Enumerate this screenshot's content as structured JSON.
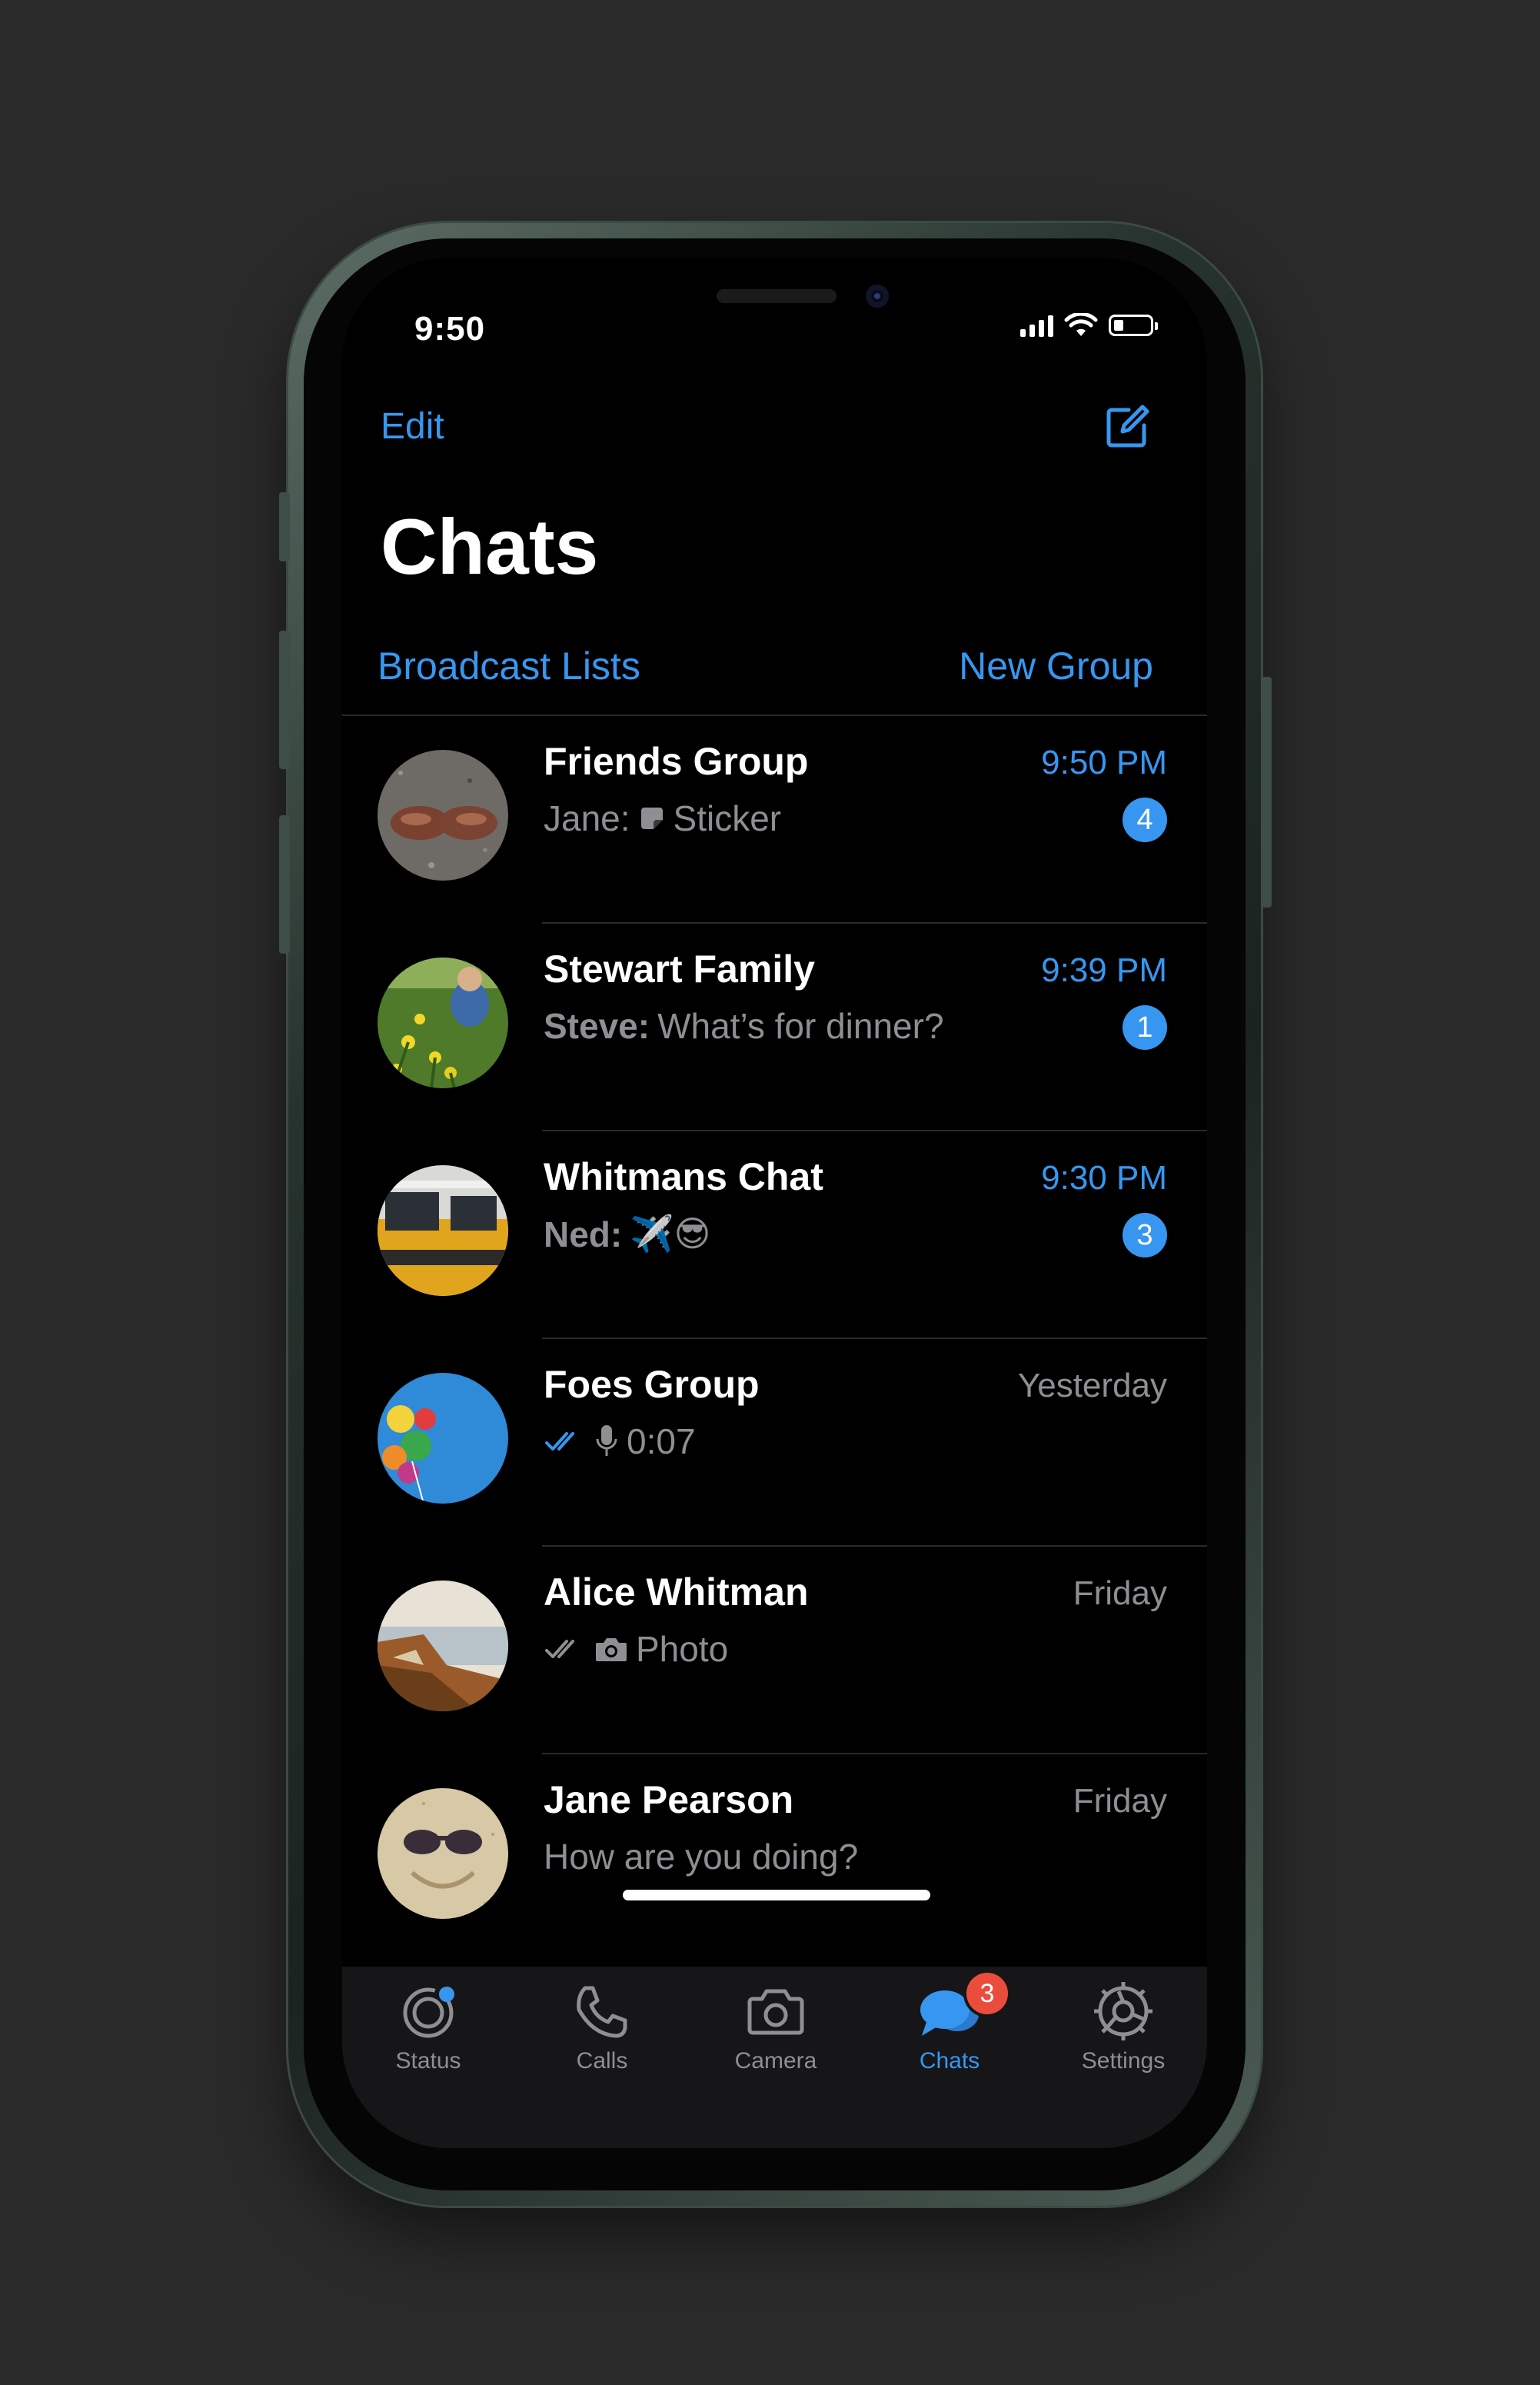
{
  "status_bar": {
    "time": "9:50"
  },
  "header": {
    "edit_label": "Edit",
    "title": "Chats",
    "broadcast_label": "Broadcast Lists",
    "new_group_label": "New Group"
  },
  "chats": [
    {
      "name": "Friends Group",
      "sender": "Jane:",
      "preview": "Sticker",
      "time": "9:50 PM",
      "unread": "4"
    },
    {
      "name": "Stewart Family",
      "sender": "Steve:",
      "preview": "What’s for dinner?",
      "time": "9:39 PM",
      "unread": "1"
    },
    {
      "name": "Whitmans Chat",
      "sender": "Ned:",
      "preview": "✈️😎",
      "time": "9:30 PM",
      "unread": "3"
    },
    {
      "name": "Foes Group",
      "preview": "0:07",
      "time": "Yesterday"
    },
    {
      "name": "Alice Whitman",
      "preview": "Photo",
      "time": "Friday"
    },
    {
      "name": "Jane Pearson",
      "preview": "How are you doing?",
      "time": "Friday"
    }
  ],
  "tabs": [
    {
      "label": "Status",
      "icon": "status-icon"
    },
    {
      "label": "Calls",
      "icon": "phone-icon"
    },
    {
      "label": "Camera",
      "icon": "camera-icon"
    },
    {
      "label": "Chats",
      "icon": "chats-icon",
      "badge": "3",
      "active": true
    },
    {
      "label": "Settings",
      "icon": "gear-icon"
    }
  ],
  "colors": {
    "accent": "#3797f0",
    "badge_red": "#eb4d3d",
    "secondary_text": "#8e8e93",
    "background": "#000000"
  }
}
